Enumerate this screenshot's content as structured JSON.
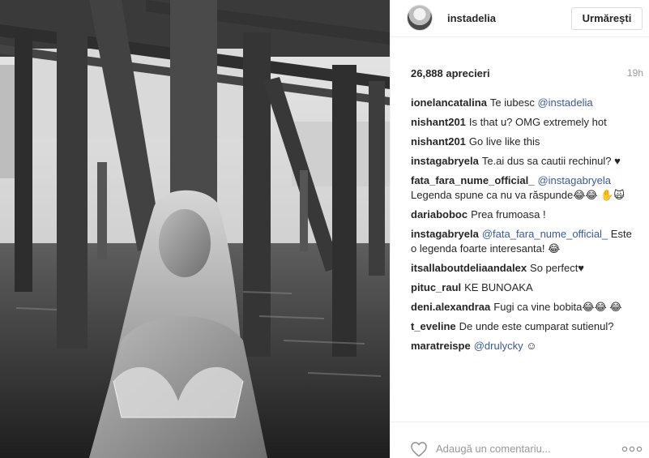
{
  "header": {
    "username": "instadelia",
    "follow_label": "Urmărești"
  },
  "stats": {
    "likes": "26,888 aprecieri",
    "time": "19h"
  },
  "comments": [
    {
      "author": "ionelancatalina",
      "text": "Te iubesc ",
      "mention": "@instadelia",
      "after": ""
    },
    {
      "author": "nishant201",
      "text": "Is that u? OMG extremely hot",
      "mention": "",
      "after": ""
    },
    {
      "author": "nishant201",
      "text": "Go live like this",
      "mention": "",
      "after": ""
    },
    {
      "author": "instagabryela",
      "text": "Te.ai dus sa cautii rechinul? ♥",
      "mention": "",
      "after": ""
    },
    {
      "author": "fata_fara_nume_official_",
      "text": "",
      "mention": "@instagabryela",
      "after": " Legenda spune ca nu va răspunde😂😂 ✋🙀"
    },
    {
      "author": "dariaboboc",
      "text": "Prea frumoasa !",
      "mention": "",
      "after": ""
    },
    {
      "author": "instagabryela",
      "text": "",
      "mention": "@fata_fara_nume_official_",
      "after": " Este o legenda foarte interesanta! 😂"
    },
    {
      "author": "itsallaboutdeliaandalex",
      "text": "So perfect♥",
      "mention": "",
      "after": ""
    },
    {
      "author": "pituc_raul",
      "text": "KE BUNOAKA",
      "mention": "",
      "after": ""
    },
    {
      "author": "deni.alexandraa",
      "text": "Fugi ca vine bobita😂😂 😂",
      "mention": "",
      "after": ""
    },
    {
      "author": "t_eveline",
      "text": "De unde este cumparat sutienul?",
      "mention": "",
      "after": ""
    },
    {
      "author": "maratreispe",
      "text": "",
      "mention": "@drulycky",
      "after": " ☺"
    }
  ],
  "footer": {
    "comment_placeholder": "Adaugă un comentariu...",
    "like_icon": "heart-outline-icon",
    "more_icon": "more-options-icon"
  }
}
